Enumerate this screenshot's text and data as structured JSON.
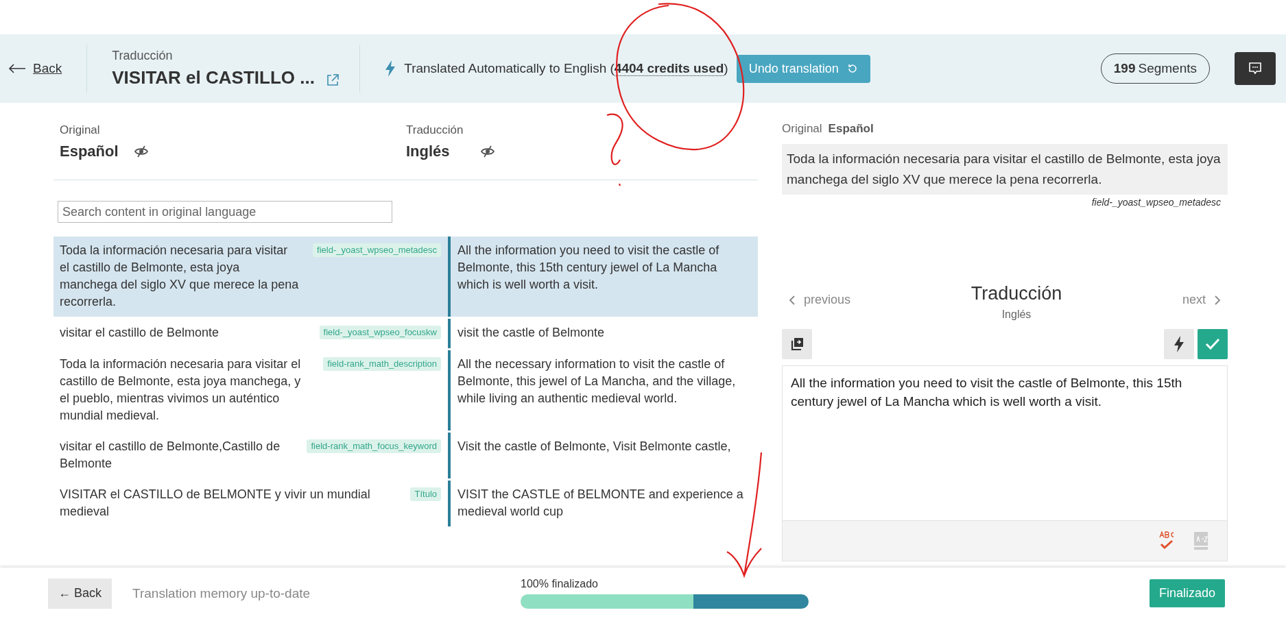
{
  "header": {
    "back": "Back",
    "title_label": "Traducción",
    "title": "VISITAR el CASTILLO ...",
    "status_text": "Translated Automatically to English (**4404 credits used**)",
    "undo_button": "Undo translation",
    "segments_count": "199",
    "segments_label": "Segments"
  },
  "columns": [
    {
      "label": "Original",
      "language": "Español"
    },
    {
      "label": "Traducción",
      "language": "Inglés"
    }
  ],
  "search": {
    "placeholder": "Search content in original language"
  },
  "segments": [
    {
      "source": "Toda la información necesaria para visitar el castillo de Belmonte, esta joya manchega del siglo XV que merece la pena recorrerla.",
      "tag": "field-_yoast_wpseo_metadesc",
      "target": "All the information you need to visit the castle of Belmonte, this 15th century jewel of La Mancha which is well worth a visit.",
      "selected": true
    },
    {
      "source": "visitar el castillo de Belmonte",
      "tag": "field-_yoast_wpseo_focuskw",
      "target": "visit the castle of Belmonte",
      "selected": false
    },
    {
      "source": "Toda la información necesaria para visitar el castillo de Belmonte, esta joya manchega, y el pueblo, mientras vivimos un auténtico mundial medieval.",
      "tag": "field-rank_math_description",
      "target": "All the necessary information to visit the castle of Belmonte, this jewel of La Mancha, and the village, while living an authentic medieval world.",
      "selected": false
    },
    {
      "source": "visitar el castillo de Belmonte,Castillo de Belmonte",
      "tag": "field-rank_math_focus_keyword",
      "target": "Visit the castle of Belmonte, Visit Belmonte castle,",
      "selected": false
    },
    {
      "source": "VISITAR el CASTILLO de BELMONTE y vivir un mundial medieval",
      "tag": "Título",
      "target": "VISIT the CASTLE of BELMONTE and experience a medieval world cup",
      "selected": false
    }
  ],
  "editor": {
    "source_label": "Original",
    "source_language": "Español",
    "source_text": "Toda la información necesaria para visitar el castillo de Belmonte, esta joya manchega del siglo XV que merece la pena recorrerla.",
    "field": "field-_yoast_wpseo_metadesc",
    "previous": "previous",
    "title": "Traducción",
    "language": "Inglés",
    "next": "next",
    "value": "All the information you need to visit the castle of Belmonte, this 15th century jewel of La Mancha which is well worth a visit."
  },
  "footer": {
    "back": "← Back",
    "status": "Translation memory up-to-date",
    "progress_label": "100% finalizado",
    "progress": [
      {
        "level": 0.6
      },
      {
        "level": 0.4
      }
    ],
    "finish_button": "Finalizado"
  }
}
